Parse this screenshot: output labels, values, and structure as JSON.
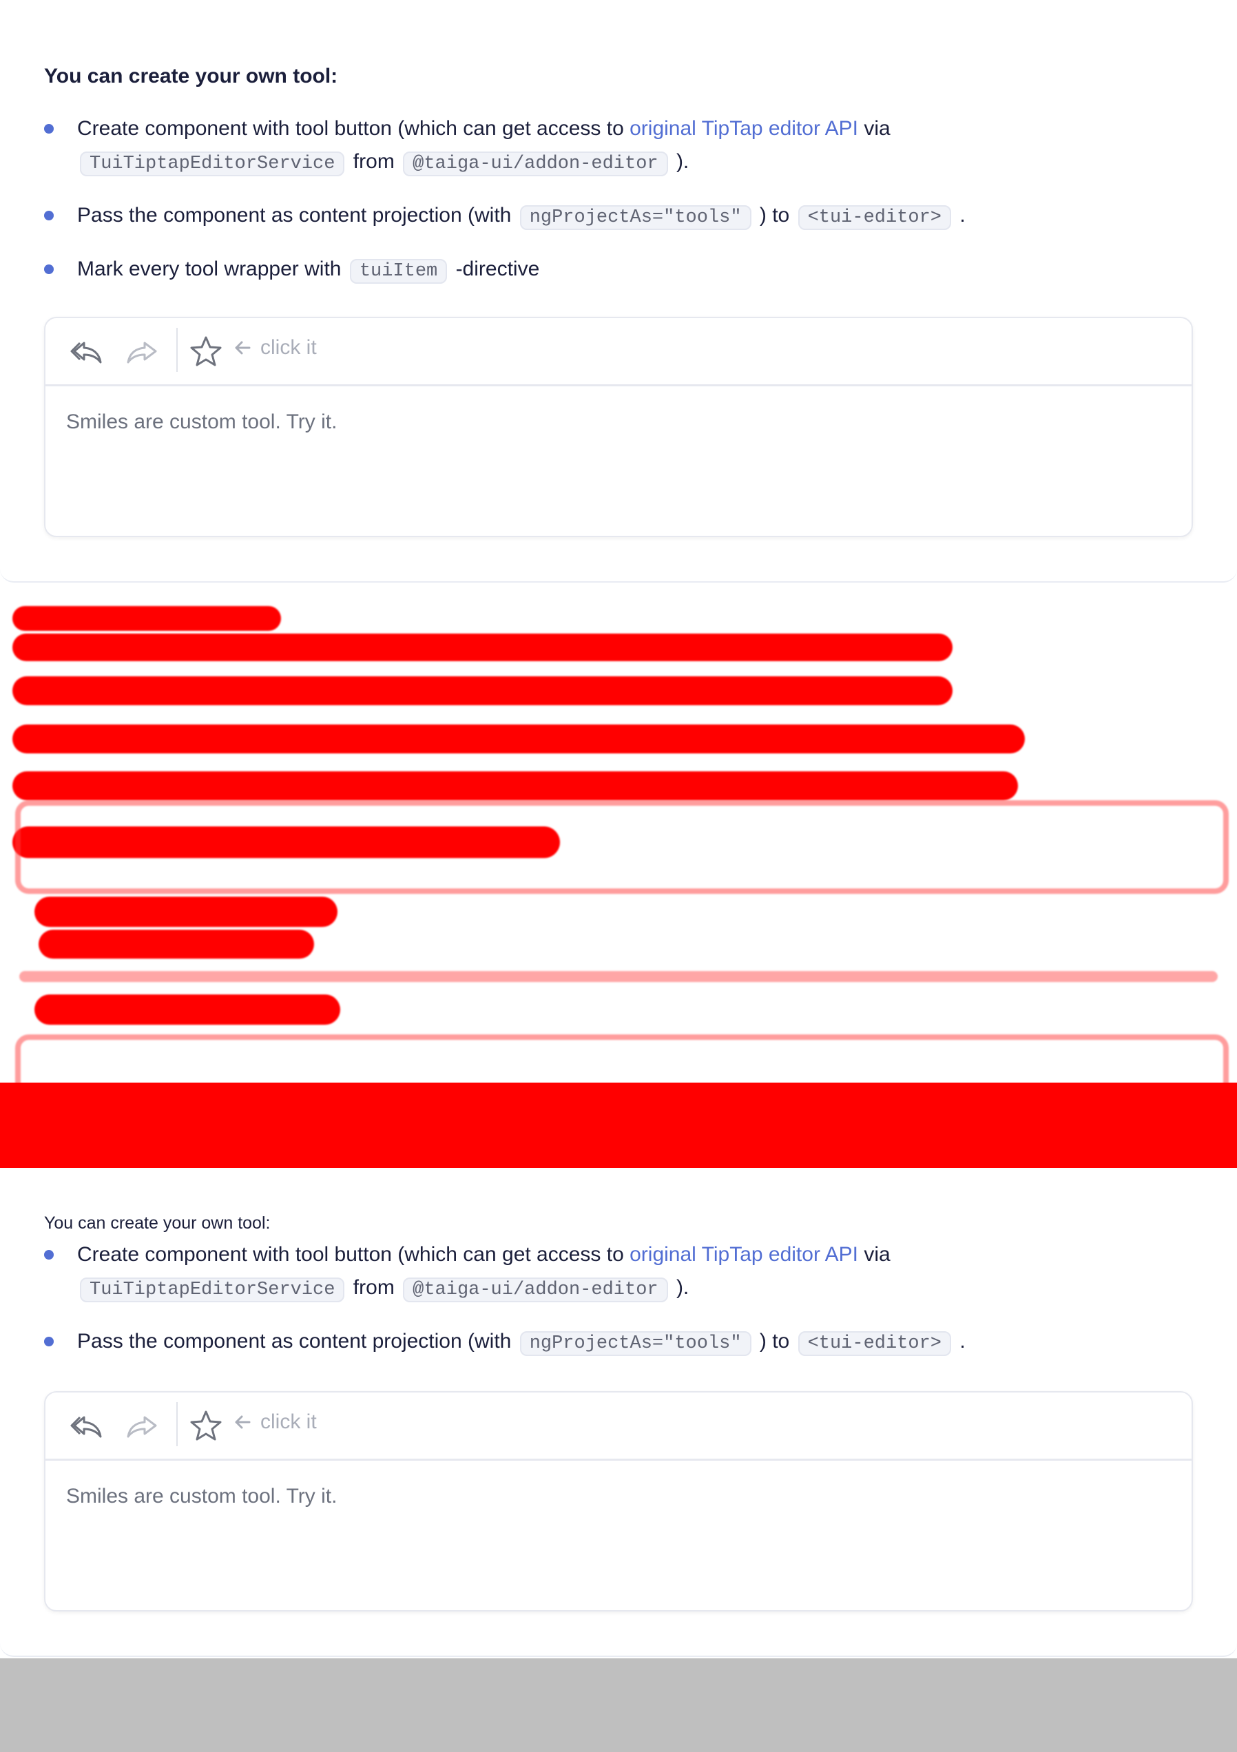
{
  "section_top": {
    "heading": "You can create your own tool:",
    "bullets": {
      "b1_part1": "Create component with tool button (which can get access to ",
      "b1_link": "original TipTap editor API",
      "b1_part2": " via",
      "b1_code1": "TuiTiptapEditorService",
      "b1_part3": " from ",
      "b1_code2": "@taiga-ui/addon-editor",
      "b1_part4": " ).",
      "b2_part1": "Pass the component as content projection (with ",
      "b2_code1": "ngProjectAs=\"tools\"",
      "b2_part2": " ) to ",
      "b2_code2": "<tui-editor>",
      "b2_part3": " .",
      "b3_part1": "Mark every tool wrapper with ",
      "b3_code1": "tuiItem",
      "b3_part2": " -directive"
    },
    "editor": {
      "hint": "click it",
      "content": "Smiles are custom tool. Try it."
    }
  },
  "section_bottom": {
    "heading": "You can create your own tool:",
    "bullets": {
      "b1_part1": "Create component with tool button (which can get access to ",
      "b1_link": "original TipTap editor API",
      "b1_part2": " via",
      "b1_code1": "TuiTiptapEditorService",
      "b1_part3": " from ",
      "b1_code2": "@taiga-ui/addon-editor",
      "b1_part4": " ).",
      "b2_part1": "Pass the component as content projection (with ",
      "b2_code1": "ngProjectAs=\"tools\"",
      "b2_part2": " ) to ",
      "b2_code2": "<tui-editor>",
      "b2_part3": " ."
    },
    "editor": {
      "hint": "click it",
      "content": "Smiles are custom tool. Try it."
    }
  },
  "icons": {
    "undo": "undo-icon",
    "redo": "redo-icon",
    "star": "star-icon",
    "arrow_left": "arrow-left-icon"
  },
  "colors": {
    "accent": "#526ed3",
    "text": "#1b1f3b",
    "muted": "#6c717e",
    "hint": "#a9adb8",
    "redaction": "#ff0000",
    "footer": "#bfbfbf"
  }
}
